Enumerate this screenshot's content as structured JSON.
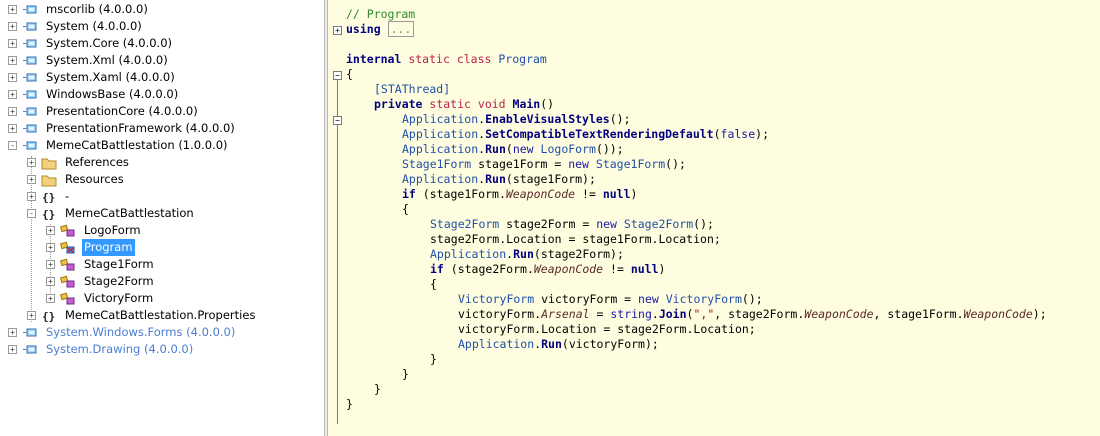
{
  "tree": {
    "items": [
      {
        "label": "mscorlib (4.0.0.0)",
        "expander": "+",
        "icon": "assembly-icon",
        "style": "normal"
      },
      {
        "label": "System (4.0.0.0)",
        "expander": "+",
        "icon": "assembly-icon",
        "style": "normal"
      },
      {
        "label": "System.Core (4.0.0.0)",
        "expander": "+",
        "icon": "assembly-icon",
        "style": "normal"
      },
      {
        "label": "System.Xml (4.0.0.0)",
        "expander": "+",
        "icon": "assembly-icon",
        "style": "normal"
      },
      {
        "label": "System.Xaml (4.0.0.0)",
        "expander": "+",
        "icon": "assembly-icon",
        "style": "normal"
      },
      {
        "label": "WindowsBase (4.0.0.0)",
        "expander": "+",
        "icon": "assembly-icon",
        "style": "normal"
      },
      {
        "label": "PresentationCore (4.0.0.0)",
        "expander": "+",
        "icon": "assembly-icon",
        "style": "normal"
      },
      {
        "label": "PresentationFramework (4.0.0.0)",
        "expander": "+",
        "icon": "assembly-icon",
        "style": "normal"
      },
      {
        "label": "MemeCatBattlestation (1.0.0.0)",
        "expander": "-",
        "icon": "assembly-icon",
        "style": "normal"
      },
      {
        "label": "References",
        "expander": "+",
        "icon": "references-folder-icon",
        "style": "normal"
      },
      {
        "label": "Resources",
        "expander": "+",
        "icon": "resources-folder-icon",
        "style": "normal"
      },
      {
        "label": "-",
        "expander": "+",
        "icon": "namespace-icon",
        "style": "normal"
      },
      {
        "label": "MemeCatBattlestation",
        "expander": "-",
        "icon": "namespace-icon",
        "style": "normal"
      },
      {
        "label": "LogoForm",
        "expander": "+",
        "icon": "class-icon",
        "style": "normal"
      },
      {
        "label": "Program",
        "expander": "+",
        "icon": "static-class-icon",
        "style": "selected"
      },
      {
        "label": "Stage1Form",
        "expander": "+",
        "icon": "class-icon",
        "style": "normal"
      },
      {
        "label": "Stage2Form",
        "expander": "+",
        "icon": "class-icon",
        "style": "normal"
      },
      {
        "label": "VictoryForm",
        "expander": "+",
        "icon": "class-icon",
        "style": "normal"
      },
      {
        "label": "MemeCatBattlestation.Properties",
        "expander": "+",
        "icon": "namespace-icon",
        "style": "normal"
      },
      {
        "label": "System.Windows.Forms (4.0.0.0)",
        "expander": "+",
        "icon": "assembly-icon",
        "style": "gray"
      },
      {
        "label": "System.Drawing (4.0.0.0)",
        "expander": "+",
        "icon": "assembly-icon",
        "style": "gray"
      }
    ]
  },
  "code": {
    "comment": "// Program",
    "using_keyword": "using",
    "using_collapsed": "...",
    "class_decl": {
      "internal": "internal",
      "static": "static",
      "class": "class",
      "name": "Program"
    },
    "open_brace": "{",
    "attribute": "[STAThread]",
    "method_decl": {
      "private": "private",
      "static": "static",
      "void": "void",
      "name": "Main",
      "parens": "()"
    },
    "lines": [
      "Application.EnableVisualStyles();",
      "Application.SetCompatibleTextRenderingDefault(false);",
      "Application.Run(new LogoForm());",
      "Stage1Form stage1Form = new Stage1Form();",
      "Application.Run(stage1Form);",
      "if (stage1Form.WeaponCode != null)",
      "{",
      "Stage2Form stage2Form = new Stage2Form();",
      "stage2Form.Location = stage1Form.Location;",
      "Application.Run(stage2Form);",
      "if (stage2Form.WeaponCode != null)",
      "{",
      "VictoryForm victoryForm = new VictoryForm();",
      "victoryForm.Arsenal = string.Join(\",\", stage2Form.WeaponCode, stage1Form.WeaponCode);",
      "victoryForm.Location = stage2Form.Location;",
      "Application.Run(victoryForm);",
      "}",
      "}",
      "}",
      "}"
    ]
  }
}
